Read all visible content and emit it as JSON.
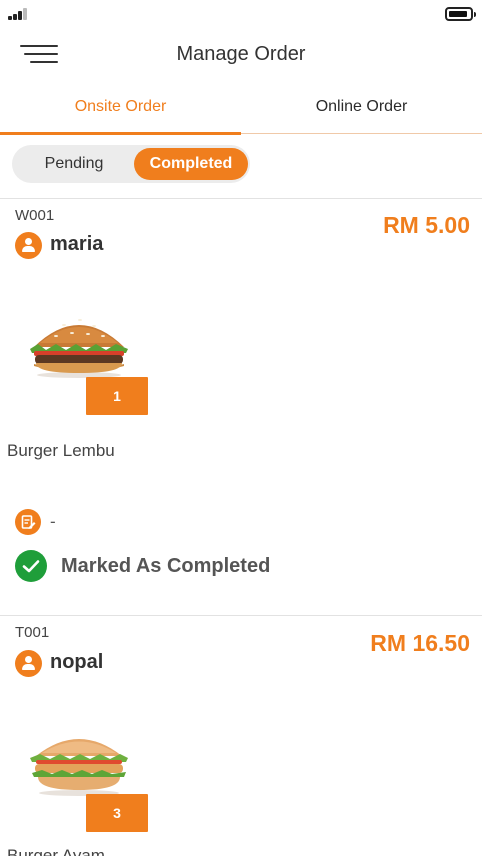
{
  "header": {
    "title": "Manage Order"
  },
  "tabs": [
    {
      "label": "Onsite Order"
    },
    {
      "label": "Online Order"
    }
  ],
  "filter": {
    "pending_label": "Pending",
    "completed_label": "Completed"
  },
  "orders": [
    {
      "code": "W001",
      "price": "RM 5.00",
      "customer": "maria",
      "item": {
        "quantity": "1",
        "name": "Burger Lembu",
        "image": "beef-burger-image"
      },
      "note": "-",
      "status": "Marked As Completed"
    },
    {
      "code": "T001",
      "price": "RM 16.50",
      "customer": "nopal",
      "item": {
        "quantity": "3",
        "name": "Burger Ayam",
        "image": "chicken-burger-image"
      }
    }
  ],
  "colors": {
    "accent": "#f07e1d",
    "success": "#1f9e3a"
  }
}
